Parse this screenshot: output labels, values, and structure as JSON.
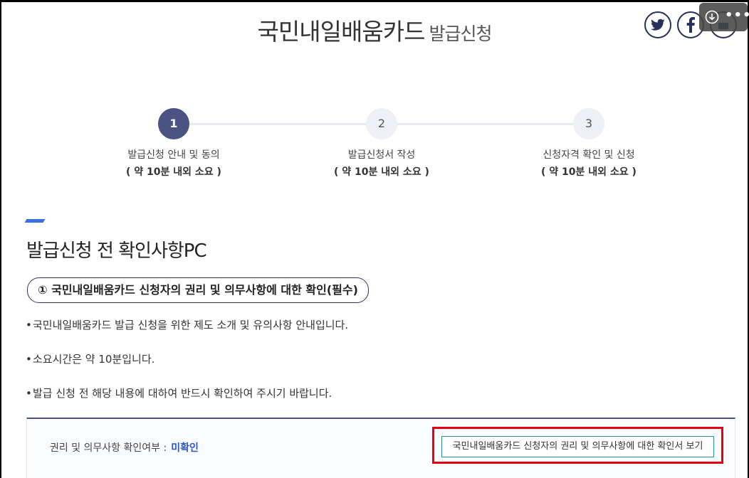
{
  "header": {
    "title_main": "국민내일배움카드",
    "title_sub": "발급신청"
  },
  "social": {
    "twitter_icon": "twitter-icon",
    "facebook_icon": "facebook-icon",
    "share_icon": "share-icon"
  },
  "overlay": {
    "download_icon": "download-icon",
    "more_icon": "more-icon",
    "dots": "•••"
  },
  "steps": [
    {
      "number": "1",
      "label": "발급신청 안내 및 동의",
      "duration": "( 약 10분 내외 소요 )",
      "state": "active"
    },
    {
      "number": "2",
      "label": "발급신청서 작성",
      "duration": "( 약 10분 내외 소요 )",
      "state": "inactive"
    },
    {
      "number": "3",
      "label": "신청자격 확인 및 신청",
      "duration": "( 약 10분 내외 소요 )",
      "state": "inactive"
    }
  ],
  "section": {
    "title": "발급신청 전 확인사항PC",
    "pill": "① 국민내일배움카드 신청자의 권리 및 의무사항에 대한 확인(필수)",
    "bullets": [
      "국민내일배움카드 발급 신청을 위한 제도 소개 및 유의사항 안내입니다.",
      "소요시간은 약 10분입니다.",
      "발급 신청 전 해당 내용에 대하여 반드시 확인하여 주시기 바랍니다."
    ],
    "bullet_mark": "•"
  },
  "confirm": {
    "status_label": "권리 및 의무사항 확인여부 :",
    "status_value": "미확인",
    "view_button": "국민내일배움카드 신청자의 권리 및 의무사항에 대한 확인서 보기"
  },
  "colors": {
    "accent": "#3b6fe0",
    "step_active": "#4b5382",
    "status_value": "#2c56c9",
    "highlight": "#e60012"
  }
}
